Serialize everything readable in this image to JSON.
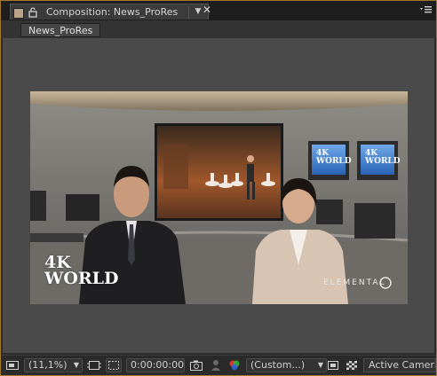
{
  "panel": {
    "tab_title": "Composition: News_ProRes",
    "dropdown_glyph": "▼",
    "close_glyph": "✕"
  },
  "viewer": {
    "comp_tab_label": "News_ProRes"
  },
  "composition_frame": {
    "overlay_line1": "4K",
    "overlay_line2": "WORLD",
    "brand_text": "ELEMENTAL",
    "monitor_line1": "4K",
    "monitor_line2": "WORLD"
  },
  "toolbar": {
    "zoom_value": "(11,1%)",
    "timecode": "0:00:00:00",
    "view_layout": "(Custom...)",
    "camera_value": "Active Camera",
    "dropdown_glyph": "▼"
  },
  "colors": {
    "panel_border": "#a07a2a",
    "background": "#2b2b2b",
    "viewer_background": "#4a4a4a"
  }
}
